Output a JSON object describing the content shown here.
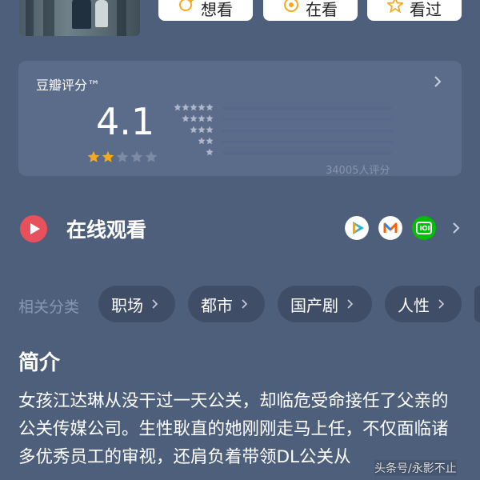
{
  "actions": {
    "want": "想看",
    "watching": "在看",
    "watched": "看过"
  },
  "rating": {
    "title": "豆瓣评分™",
    "score": "4.1",
    "stars_filled": 2,
    "stars_total": 5,
    "count_text": "34005人评分",
    "distribution": [
      {
        "stars": 5,
        "fraction": 0.0
      },
      {
        "stars": 4,
        "fraction": 0.0
      },
      {
        "stars": 3,
        "fraction": 0.0
      },
      {
        "stars": 2,
        "fraction": 0.0
      },
      {
        "stars": 1,
        "fraction": 0.0
      }
    ],
    "star_color": "#f6a821"
  },
  "watch": {
    "title": "在线观看",
    "apps": [
      "tencent-video-icon",
      "mgtv-icon",
      "iqiyi-icon"
    ]
  },
  "categories": {
    "label": "相关分类",
    "chips": [
      "职场",
      "都市",
      "国产剧",
      "人性"
    ]
  },
  "synopsis": {
    "title": "简介",
    "text": "女孩江达琳从没干过一天公关，却临危受命接任了父亲的公关传媒公司。生性耿直的她刚刚走马上任，不仅面临诸多优秀员工的审视，还肩负着带领DL公关从"
  },
  "watermark": "头条号/永影不止",
  "colors": {
    "background": "#4e5f7c",
    "card": "#5b6c8a",
    "chip": "#3f4d66",
    "play_red": "#e8505b"
  }
}
